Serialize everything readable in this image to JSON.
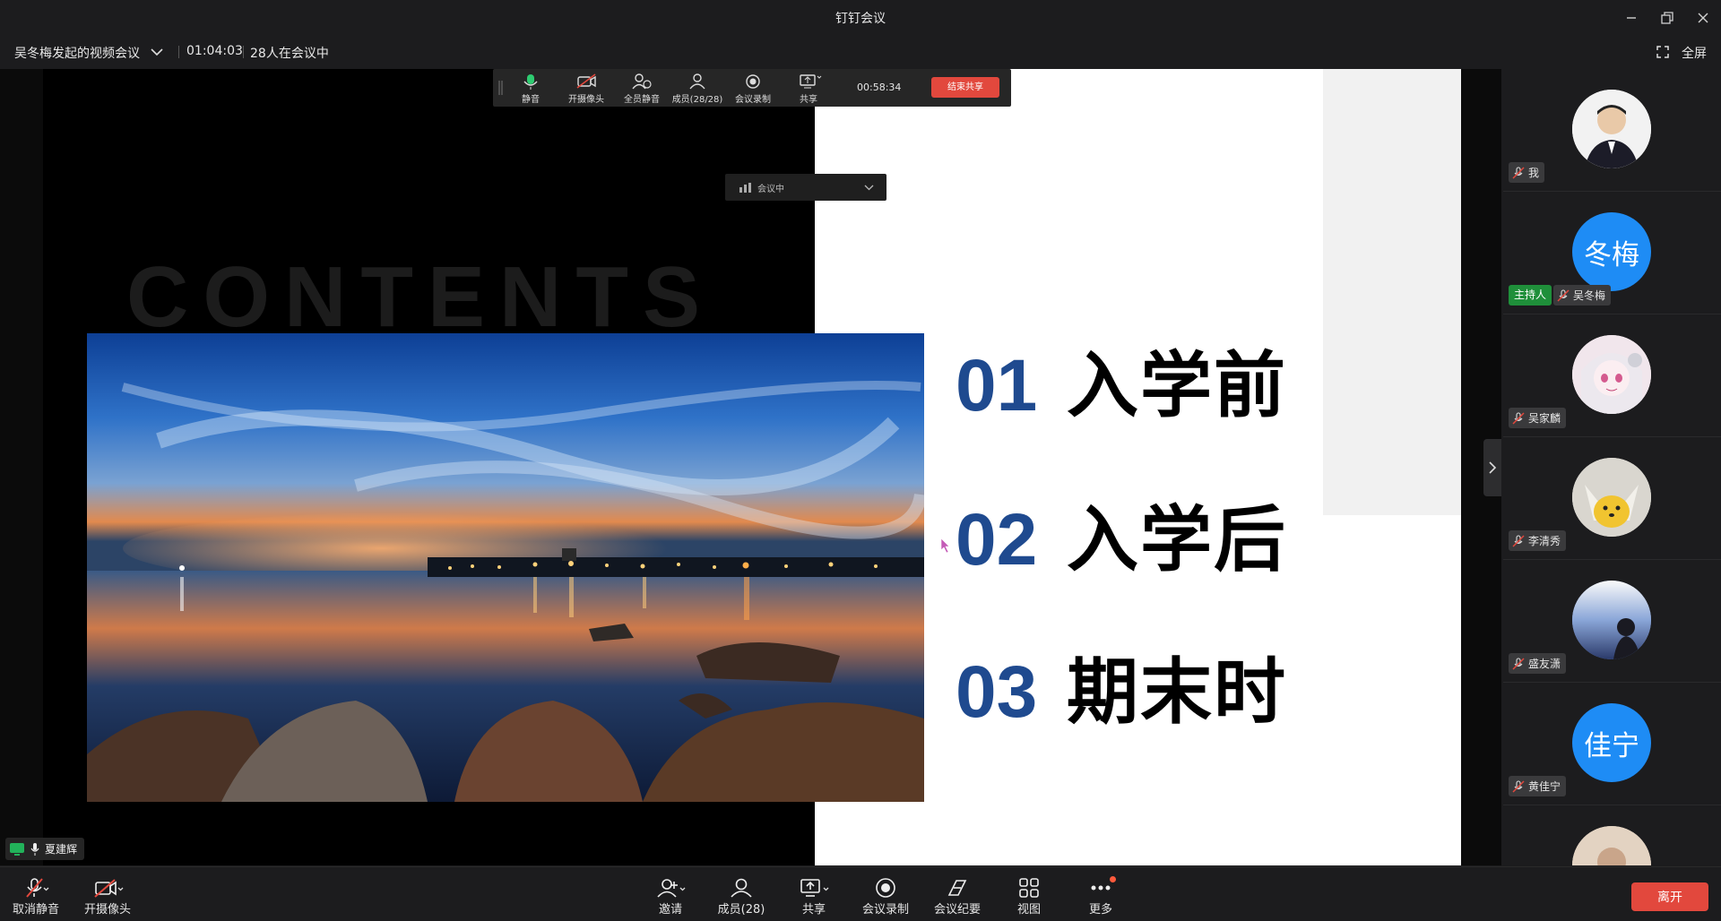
{
  "window": {
    "title": "钉钉会议"
  },
  "infobar": {
    "meeting_name": "吴冬梅发起的视频会议",
    "elapsed": "01:04:03",
    "attendees": "28人在会议中",
    "fullscreen": "全屏"
  },
  "slide": {
    "bg_word": "CONTENTS",
    "toc": [
      {
        "num": "01",
        "text": "入学前"
      },
      {
        "num": "02",
        "text": "入学后"
      },
      {
        "num": "03",
        "text": "期末时"
      }
    ]
  },
  "sharebar": {
    "mute": "静音",
    "camera": "开摄像头",
    "mute_all": "全员静音",
    "members": "成员(28/28)",
    "record": "会议录制",
    "share": "共享",
    "timer": "00:58:34",
    "end_share": "结束共享"
  },
  "meeting_pill": {
    "label": "会议中"
  },
  "speaker": {
    "name": "夏建辉"
  },
  "participants": [
    {
      "name": "我",
      "avatar": "photo-man"
    },
    {
      "name": "吴冬梅",
      "avatar_text": "冬梅",
      "host_label": "主持人"
    },
    {
      "name": "吴家麟",
      "avatar": "anime-girl"
    },
    {
      "name": "李清秀",
      "avatar": "cartoon-fox"
    },
    {
      "name": "盛友潇",
      "avatar": "sky-boy"
    },
    {
      "name": "黄佳宁",
      "avatar_text": "佳宁"
    },
    {
      "name": "",
      "avatar": "partial"
    }
  ],
  "bottombar": {
    "unmute": "取消静音",
    "camera": "开摄像头",
    "invite": "邀请",
    "members": "成员(28)",
    "share": "共享",
    "record": "会议录制",
    "minutes": "会议纪要",
    "view": "视图",
    "more": "更多",
    "leave": "离开"
  },
  "colors": {
    "accent": "#1e8cf5",
    "danger": "#e2483d",
    "host": "#1f8f3a",
    "toc_num": "#1f4a8f"
  }
}
